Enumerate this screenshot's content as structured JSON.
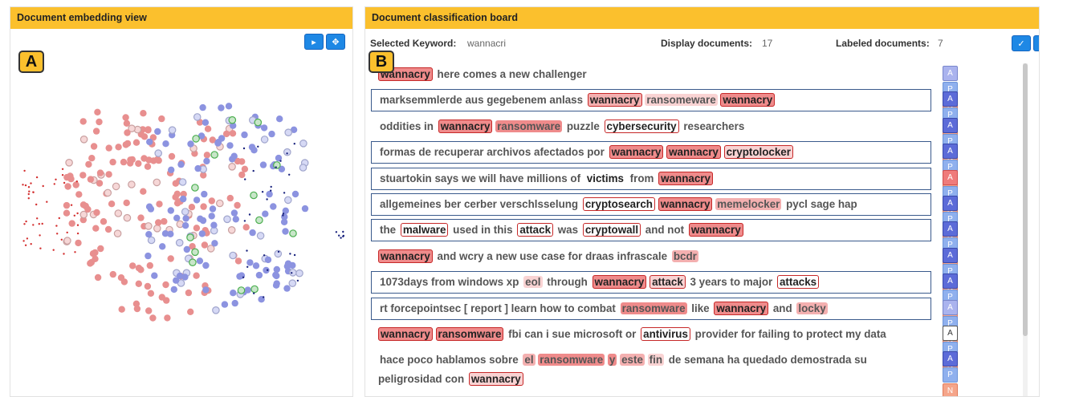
{
  "left": {
    "title": "Document embedding view",
    "tag": "A",
    "play_icon": "play-icon",
    "move_icon": "move-icon"
  },
  "right": {
    "title": "Document classification board",
    "tag": "B",
    "selected_keyword_label": "Selected Keyword:",
    "selected_keyword_value": "wannacri",
    "display_docs_label": "Display documents:",
    "display_docs_value": "17",
    "labeled_docs_label": "Labeled documents:",
    "labeled_docs_value": "7",
    "confirm_icon": "check-icon",
    "reset_icon": "refresh-icon"
  },
  "label_buttons": [
    "A",
    "P",
    "N"
  ],
  "documents": [
    {
      "boxed": false,
      "tall": false,
      "a_style": "light",
      "tokens": [
        [
          "wannacry",
          "kw h3"
        ],
        [
          "here comes a new challenger",
          ""
        ]
      ]
    },
    {
      "boxed": true,
      "tall": false,
      "a_style": "",
      "tokens": [
        [
          "marksemmlerde aus gegebenem anlass",
          ""
        ],
        [
          "wannacry",
          "kw h2"
        ],
        [
          "ransomeware",
          "h1"
        ],
        [
          "wannacry",
          "kw h3"
        ]
      ]
    },
    {
      "boxed": false,
      "tall": false,
      "a_style": "",
      "tokens": [
        [
          "oddities in",
          ""
        ],
        [
          "wannacry",
          "kw h3"
        ],
        [
          "ransomware",
          "h3"
        ],
        [
          "puzzle",
          ""
        ],
        [
          "cybersecurity",
          "kw"
        ],
        [
          "researchers",
          ""
        ]
      ]
    },
    {
      "boxed": true,
      "tall": false,
      "a_style": "",
      "tokens": [
        [
          "formas de recuperar archivos afectados por",
          ""
        ],
        [
          "wannacry",
          "kw h3"
        ],
        [
          "wannacry",
          "kw h3"
        ],
        [
          "cryptolocker",
          "kw h1"
        ]
      ]
    },
    {
      "boxed": true,
      "tall": false,
      "a_style": "red",
      "tokens": [
        [
          "stuartokin says we will have millions of",
          ""
        ],
        [
          "victims",
          "dark"
        ],
        [
          "from",
          ""
        ],
        [
          "wannacry",
          "kw h3"
        ]
      ]
    },
    {
      "boxed": true,
      "tall": false,
      "a_style": "",
      "tokens": [
        [
          "allgemeines ber cerber verschlsselung",
          ""
        ],
        [
          "cryptosearch",
          "kw"
        ],
        [
          "wannacry",
          "kw h3"
        ],
        [
          "memelocker",
          "h2"
        ],
        [
          "pycl sage hap",
          ""
        ]
      ]
    },
    {
      "boxed": true,
      "tall": false,
      "a_style": "",
      "tokens": [
        [
          "the",
          ""
        ],
        [
          "malware",
          "kw"
        ],
        [
          "used in this",
          ""
        ],
        [
          "attack",
          "kw"
        ],
        [
          "was",
          ""
        ],
        [
          "cryptowall",
          "kw"
        ],
        [
          "and not",
          ""
        ],
        [
          "wannacry",
          "kw h3"
        ]
      ]
    },
    {
      "boxed": false,
      "tall": false,
      "a_style": "",
      "tokens": [
        [
          "wannacry",
          "kw h3"
        ],
        [
          "and wcry a new use case for draas infrascale",
          ""
        ],
        [
          "bcdr",
          "h2"
        ]
      ]
    },
    {
      "boxed": true,
      "tall": false,
      "a_style": "",
      "tokens": [
        [
          "1073days from windows xp",
          ""
        ],
        [
          "eol",
          "h1"
        ],
        [
          "through",
          ""
        ],
        [
          "wannacry",
          "kw h3"
        ],
        [
          "attack",
          "kw h1"
        ],
        [
          "3 years to major",
          ""
        ],
        [
          "attacks",
          "kw"
        ]
      ]
    },
    {
      "boxed": true,
      "tall": false,
      "a_style": "light",
      "tokens": [
        [
          "rt forcepointsec [ report ] learn how to combat",
          ""
        ],
        [
          "ransomware",
          "h3"
        ],
        [
          "like",
          ""
        ],
        [
          "wannacry",
          "kw h3"
        ],
        [
          "and",
          ""
        ],
        [
          "locky",
          "h2"
        ]
      ]
    },
    {
      "boxed": false,
      "tall": false,
      "a_style": "white",
      "tokens": [
        [
          "wannacry",
          "kw h3"
        ],
        [
          "ransomware",
          "kw h3"
        ],
        [
          "fbi can i sue microsoft or",
          ""
        ],
        [
          "antivirus",
          "kw"
        ],
        [
          "provider for failing to protect my data",
          ""
        ]
      ]
    },
    {
      "boxed": false,
      "tall": true,
      "a_style": "",
      "tokens": [
        [
          "hace poco hablamos sobre",
          ""
        ],
        [
          "el",
          "h2"
        ],
        [
          "ransomware",
          "h3"
        ],
        [
          "y",
          "h3"
        ],
        [
          "este",
          "h2"
        ],
        [
          "fin",
          "h1"
        ],
        [
          "de semana ha quedado demostrada su peligrosidad con",
          ""
        ],
        [
          "wannacry",
          "kw h1"
        ]
      ]
    }
  ]
}
